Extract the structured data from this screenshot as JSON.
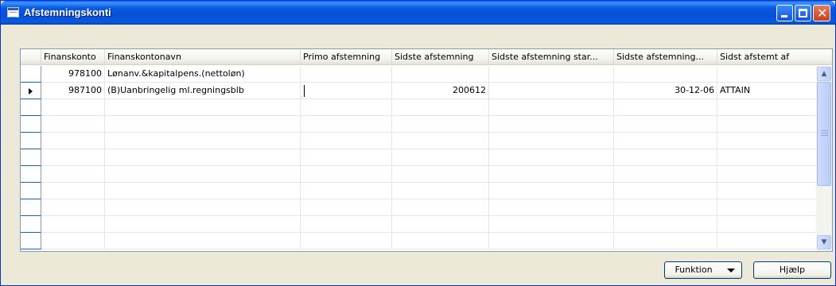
{
  "window": {
    "title": "Afstemningskonti",
    "icon": "table-icon",
    "controls": {
      "minimize": "minimize-icon",
      "maximize": "maximize-icon",
      "close": "✕"
    }
  },
  "table": {
    "columns": [
      "Finanskonto",
      "Finanskontonavn",
      "Primo afstemning",
      "Sidste afstemning",
      "Sidste afstemning star...",
      "Sidste afstemning...",
      "Sidst afstemt af"
    ],
    "rows": [
      {
        "finanskonto": "978100",
        "navn": "Lønanv.&kapitalpens.(nettoløn)",
        "primo": "",
        "sidste": "",
        "start": "",
        "dato": "",
        "af": ""
      },
      {
        "finanskonto": "987100",
        "navn": "(B)Uanbringelig ml.regningsblb",
        "primo": "",
        "sidste": "200612",
        "start": "",
        "dato": "30-12-06",
        "af": "ATTAIN"
      }
    ],
    "current_row_indicator": "record-pointer-icon"
  },
  "buttons": {
    "funktion": "Funktion",
    "hjaelp": "Hjælp"
  }
}
